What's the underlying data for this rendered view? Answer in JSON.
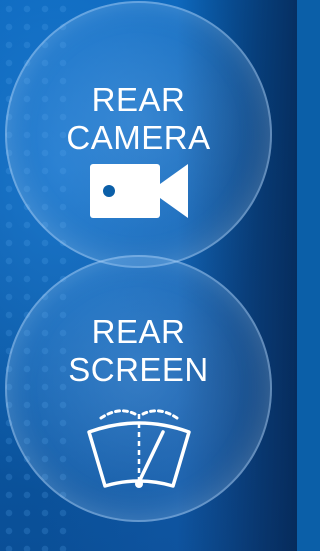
{
  "buttons": {
    "rear_camera": {
      "line1": "REAR",
      "line2": "CAMERA",
      "icon": "video-camera-icon"
    },
    "rear_screen": {
      "line1": "REAR",
      "line2": "SCREEN",
      "icon": "windshield-wiper-icon"
    }
  },
  "colors": {
    "background": "#0b5fa8",
    "text": "#ffffff"
  }
}
